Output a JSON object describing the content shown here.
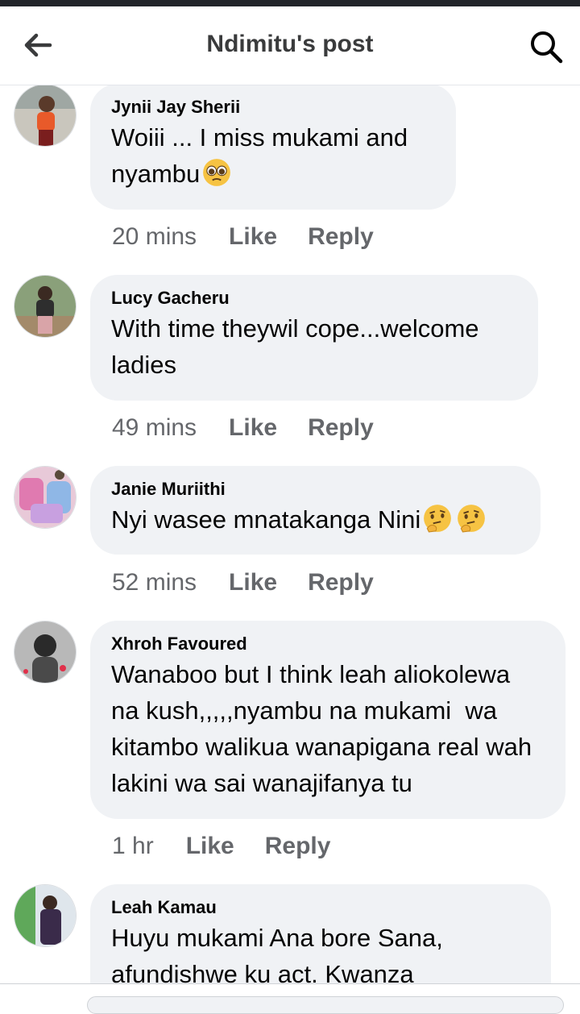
{
  "header": {
    "title": "Ndimitu's post"
  },
  "comments": [
    {
      "author": "Jynii Jay Sherii",
      "text": "Woiii ... I miss mukami and nyambu",
      "emojis": [
        "pleading-face"
      ],
      "time": "20 mins",
      "like": "Like",
      "reply": "Reply"
    },
    {
      "author": "Lucy Gacheru",
      "text": "With time theywil cope...welcome ladies",
      "emojis": [],
      "time": "49 mins",
      "like": "Like",
      "reply": "Reply"
    },
    {
      "author": "Janie Muriithi",
      "text": "Nyi wasee mnatakanga Nini",
      "emojis": [
        "thinking-face",
        "thinking-face"
      ],
      "time": "52 mins",
      "like": "Like",
      "reply": "Reply"
    },
    {
      "author": "Xhroh Favoured",
      "text": "Wanaboo but I think leah aliokolewa na kush,,,,,nyambu na mukami  wa kitambo walikua wanapigana real wah lakini wa sai wanajifanya tu",
      "emojis": [],
      "time": "1 hr",
      "like": "Like",
      "reply": "Reply"
    },
    {
      "author": "Leah Kamau",
      "text": "Huyu mukami Ana bore Sana, afundishwe ku act. Kwanza",
      "emojis": [],
      "time": "",
      "like": "",
      "reply": ""
    }
  ]
}
